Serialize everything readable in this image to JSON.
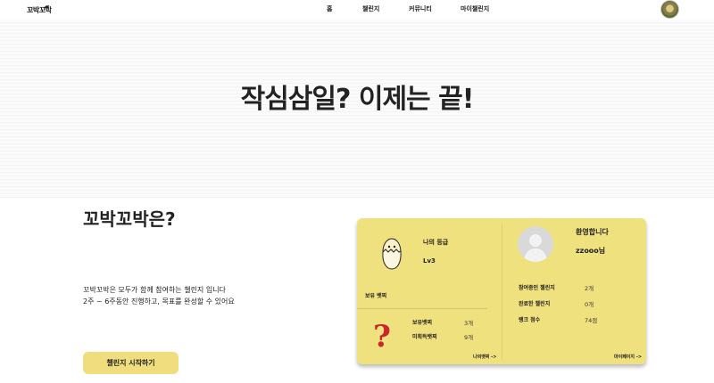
{
  "header": {
    "logo_text": "꼬박꼬박",
    "nav": [
      "홈",
      "챌린지",
      "커뮤니티",
      "마이챌린지"
    ]
  },
  "hero": {
    "title": "작심삼일? 이제는 끝!"
  },
  "about": {
    "title": "꼬박꼬박은?",
    "desc_line1": "꼬박꼬박은 모두가 함께 참여하는 챌린지 입니다",
    "desc_line2": "2주 ~ 6주동안 진행하고, 목표를 완성할 수 있어요",
    "start_button": "챌린지 시작하기"
  },
  "card": {
    "grade_label": "나의 등급",
    "grade_value": "Lv3",
    "badge_section": "보유 뱃찌",
    "owned_badges_label": "보유뱃찌",
    "owned_badges_value": "3개",
    "unowned_badges_label": "미획득뱃찌",
    "unowned_badges_value": "9개",
    "badge_link": "나의뱃찌 ->",
    "welcome": "환영합니다",
    "username": "zzooo님",
    "stats": [
      {
        "label": "참여중인 챌린지",
        "value": "2개"
      },
      {
        "label": "완료한 챌린지",
        "value": "0개"
      },
      {
        "label": "랭크 점수",
        "value": "74점"
      }
    ],
    "mypage_link": "마이페이지 ->"
  },
  "colors": {
    "card_bg": "#f0e17f",
    "button_bg": "#f0de7e",
    "question_mark": "#c8282b"
  },
  "icons": [
    "bird-logo-icon",
    "user-avatar",
    "egg-chick-icon",
    "question-mark-icon",
    "default-profile-icon"
  ]
}
